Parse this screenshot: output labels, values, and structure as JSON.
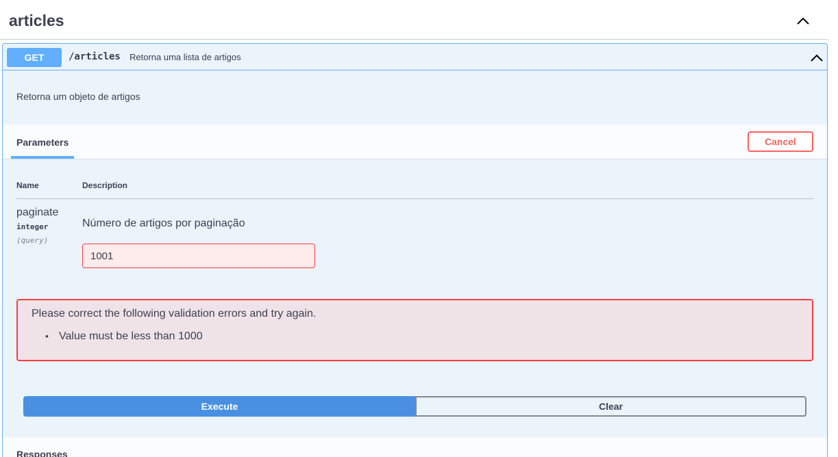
{
  "tag": {
    "title": "articles",
    "toggle_icon": "chevron-up-icon"
  },
  "operation": {
    "method": "GET",
    "path": "/articles",
    "summary": "Retorna uma lista de artigos",
    "description": "Retorna um objeto de artigos",
    "toggle_icon": "chevron-up-icon",
    "method_color": "#61affe"
  },
  "parameters": {
    "tab_label": "Parameters",
    "cancel_label": "Cancel",
    "columns": {
      "name": "Name",
      "description": "Description"
    },
    "items": [
      {
        "name": "paginate",
        "type": "integer",
        "in": "(query)",
        "description": "Número de artigos por paginação",
        "value": "1001"
      }
    ]
  },
  "validation": {
    "title": "Please correct the following validation errors and try again.",
    "errors": [
      "Value must be less than 1000"
    ],
    "error_color": "#f93e3e"
  },
  "actions": {
    "execute_label": "Execute",
    "clear_label": "Clear",
    "execute_color": "#4990e2"
  },
  "responses": {
    "label": "Responses"
  }
}
